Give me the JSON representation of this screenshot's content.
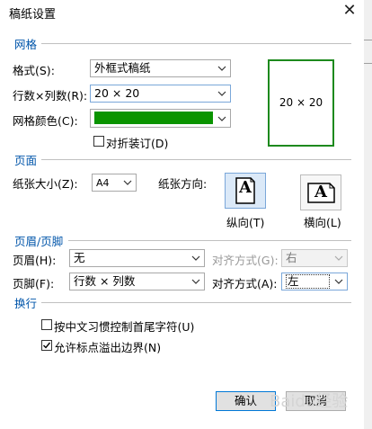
{
  "window": {
    "title": "稿纸设置",
    "close_glyph": "✕"
  },
  "grid": {
    "section": "网格",
    "format_label": "格式(S):",
    "format_value": "外框式稿纸",
    "rows_cols_label": "行数×列数(R):",
    "rows_cols_value": "20 × 20",
    "color_label": "网格颜色(C):",
    "color_value": "#0a9400",
    "fold_label": "对折装订(D)",
    "fold_checked": false,
    "preview_text": "20 × 20"
  },
  "page": {
    "section": "页面",
    "size_label": "纸张大小(Z):",
    "size_value": "A4",
    "orientation_label": "纸张方向:",
    "portrait_label": "纵向(T)",
    "landscape_label": "横向(L)",
    "orientation_icon_glyph": "A",
    "orientation_selected": "portrait"
  },
  "header_footer": {
    "section": "页眉/页脚",
    "header_label": "页眉(H):",
    "header_value": "无",
    "header_align_label": "对齐方式(G):",
    "header_align_value": "右",
    "footer_label": "页脚(F):",
    "footer_value": "行数 × 列数",
    "footer_align_label": "对齐方式(A):",
    "footer_align_value": "左"
  },
  "wrap": {
    "section": "换行",
    "option1_label": "按中文习惯控制首尾字符(U)",
    "option1_checked": false,
    "option2_label": "允许标点溢出边界(N)",
    "option2_checked": true
  },
  "buttons": {
    "ok": "确认",
    "cancel": "取消"
  },
  "watermark_text": "Baidu经验",
  "colors": {
    "accent": "#0055aa",
    "grid_green": "#0a9400",
    "preview_border": "#1d8a1d"
  }
}
